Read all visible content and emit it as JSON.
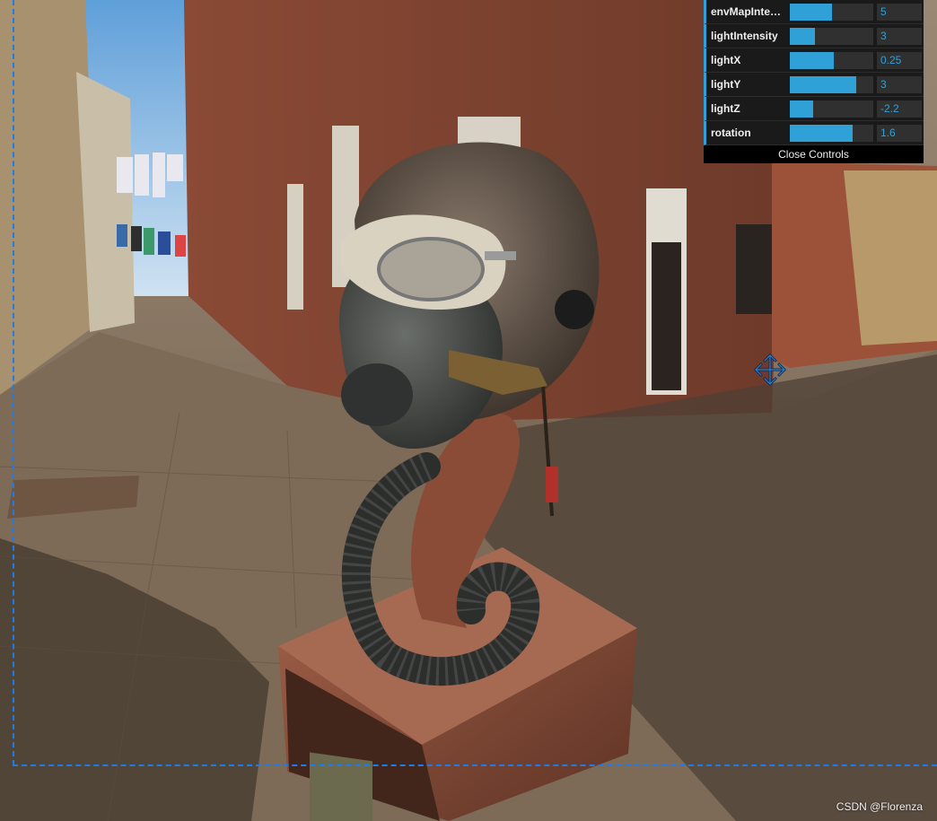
{
  "controls": {
    "rows": [
      {
        "label": "envMapIntens...",
        "value": "5",
        "fill": 0.5
      },
      {
        "label": "lightIntensity",
        "value": "3",
        "fill": 0.3
      },
      {
        "label": "lightX",
        "value": "0.25",
        "fill": 0.53
      },
      {
        "label": "lightY",
        "value": "3",
        "fill": 0.8
      },
      {
        "label": "lightZ",
        "value": "-2.2",
        "fill": 0.28
      },
      {
        "label": "rotation",
        "value": "1.6",
        "fill": 0.75
      }
    ],
    "close_label": "Close Controls"
  },
  "watermark": "CSDN @Florenza",
  "colors": {
    "accent": "#2fa1d6",
    "panel": "#1a1a1a",
    "selection": "#1e7be8"
  },
  "icons": {
    "transform": "move-arrows-icon"
  }
}
